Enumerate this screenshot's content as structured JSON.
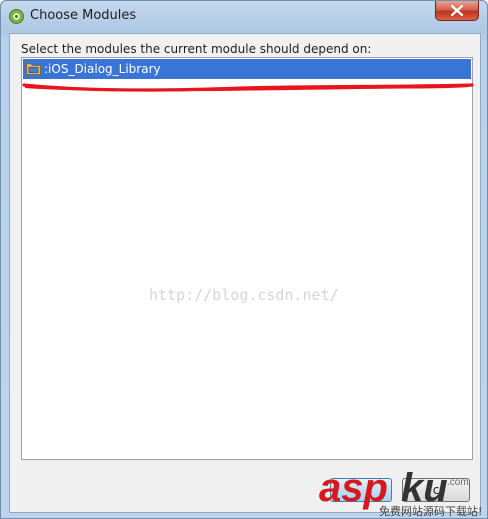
{
  "window": {
    "title": "Choose Modules",
    "icon": "android-studio-icon",
    "close_icon": "close-icon"
  },
  "dialog": {
    "prompt": "Select the modules the current module should depend on:",
    "modules": [
      {
        "label": ":iOS_Dialog_Library",
        "icon": "module-folder-icon",
        "selected": true
      }
    ],
    "watermark": "http://blog.csdn.net/"
  },
  "buttons": {
    "ok_label": "",
    "cancel_label": "c"
  },
  "overlay_logo": {
    "text": "aspku",
    "subtext": "免费网站源码下载站!",
    "colors": {
      "asp": "#d7191f",
      "ku": "#333333"
    }
  },
  "colors": {
    "selection": "#3875d7",
    "annotation_stroke": "#e8141e",
    "title_bar": "#b9d0ea"
  }
}
